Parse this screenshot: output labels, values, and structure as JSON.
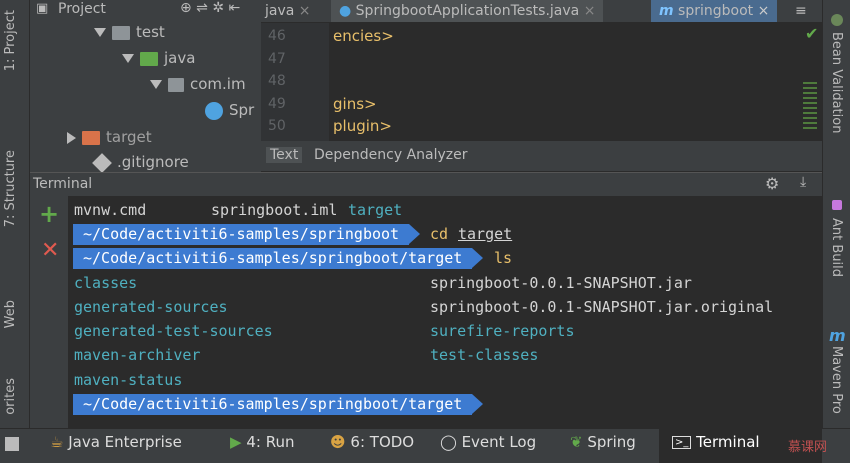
{
  "left_strip": {
    "project_tab": "1: Project",
    "structure_tab": "7: Structure",
    "web_tab": "Web",
    "favorites_tab": "orites"
  },
  "right_strip": {
    "bean_validation": "Bean Validation",
    "ant_build": "Ant Build",
    "maven_projects": "Maven Pro"
  },
  "project": {
    "title": "Project",
    "tree": [
      {
        "label": "test",
        "kind": "folder-gray"
      },
      {
        "label": "java",
        "kind": "folder-green"
      },
      {
        "label": "com.im",
        "kind": "package"
      },
      {
        "label": "Spr",
        "kind": "spring-class"
      },
      {
        "label": "target",
        "kind": "folder-orange"
      },
      {
        "label": ".gitignore",
        "kind": "file"
      }
    ]
  },
  "editor": {
    "tabs": [
      {
        "label": "java"
      },
      {
        "label": "SpringbootApplicationTests.java"
      },
      {
        "label": "springboot"
      }
    ],
    "lines": [
      {
        "num": "46",
        "code": "encies>"
      },
      {
        "num": "47",
        "code": ""
      },
      {
        "num": "48",
        "code": ""
      },
      {
        "num": "49",
        "code": "gins>"
      },
      {
        "num": "50",
        "code": "plugin>"
      }
    ],
    "bottom_tabs": [
      "Text",
      "Dependency Analyzer"
    ]
  },
  "terminal": {
    "title": "Terminal",
    "row1": {
      "a": "mvnw.cmd",
      "b": "springboot.iml",
      "c": "target"
    },
    "prompt1": {
      "path": "~/Code/activiti6-samples/springboot",
      "cmd": "cd",
      "arg": "target"
    },
    "prompt2": {
      "path": "~/Code/activiti6-samples/springboot/target",
      "cmd": "ls"
    },
    "listing_left": [
      "classes",
      "generated-sources",
      "generated-test-sources",
      "maven-archiver",
      "maven-status"
    ],
    "listing_right": [
      "springboot-0.0.1-SNAPSHOT.jar",
      "springboot-0.0.1-SNAPSHOT.jar.original",
      "surefire-reports",
      "test-classes"
    ],
    "prompt3": {
      "path": "~/Code/activiti6-samples/springboot/target"
    }
  },
  "bottom_bar": {
    "items": [
      "Java Enterprise",
      "4: Run",
      "6: TODO",
      "Event Log",
      "Spring",
      "Terminal"
    ],
    "watermark": "慕课网"
  },
  "colors": {
    "prompt_bg": "#3d7bd1",
    "dir_text": "#4fb0c0",
    "xml_tag": "#e8bf6a"
  }
}
